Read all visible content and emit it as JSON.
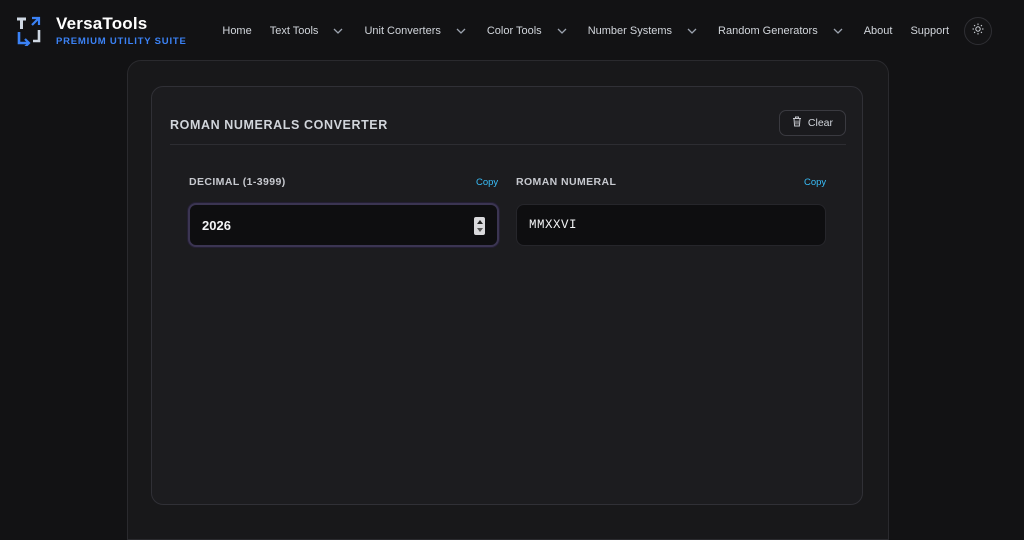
{
  "brand": {
    "name": "VersaTools",
    "tagline": "PREMIUM UTILITY SUITE",
    "accent_color": "#3b82f6"
  },
  "nav": {
    "items": [
      {
        "label": "Home",
        "dropdown": false
      },
      {
        "label": "Text Tools",
        "dropdown": true
      },
      {
        "label": "Unit Converters",
        "dropdown": true
      },
      {
        "label": "Color Tools",
        "dropdown": true
      },
      {
        "label": "Number Systems",
        "dropdown": true
      },
      {
        "label": "Random Generators",
        "dropdown": true
      },
      {
        "label": "About",
        "dropdown": false
      },
      {
        "label": "Support",
        "dropdown": false
      }
    ],
    "theme_toggle_icon": "sun-icon"
  },
  "card": {
    "title": "ROMAN NUMERALS CONVERTER",
    "clear_label": "Clear",
    "clear_icon": "trash-icon"
  },
  "decimal": {
    "label": "DECIMAL (1-3999)",
    "copy_label": "Copy",
    "value": "2026"
  },
  "roman": {
    "label": "ROMAN NUMERAL",
    "copy_label": "Copy",
    "value": "MMXXVI"
  },
  "colors": {
    "background": "#121214",
    "card": "#1c1c1f",
    "link": "#38bdf8",
    "focus_border": "#3b3552"
  }
}
